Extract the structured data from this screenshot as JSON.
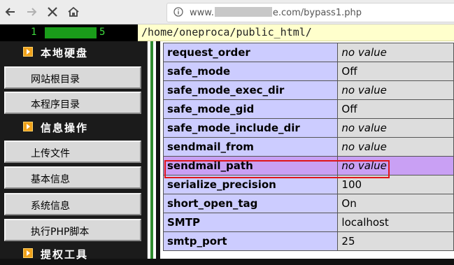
{
  "browser": {
    "url_prefix": "www.",
    "url_suffix": "e.com/bypass1.php"
  },
  "header": {
    "host_start": "1",
    "host_end": "5",
    "path": "/home/oneproca/public_html/"
  },
  "sidebar": {
    "sections": [
      {
        "label": "本地硬盘",
        "items": [
          "网站根目录",
          "本程序目录"
        ]
      },
      {
        "label": "信息操作",
        "items": [
          "上传文件",
          "基本信息",
          "系统信息",
          "执行PHP脚本"
        ]
      },
      {
        "label": "提权工具",
        "items": []
      }
    ]
  },
  "table": {
    "rows": [
      {
        "key": "request_order",
        "value": "no value",
        "italic": true
      },
      {
        "key": "safe_mode",
        "value": "Off",
        "italic": false
      },
      {
        "key": "safe_mode_exec_dir",
        "value": "no value",
        "italic": true
      },
      {
        "key": "safe_mode_gid",
        "value": "Off",
        "italic": false
      },
      {
        "key": "safe_mode_include_dir",
        "value": "no value",
        "italic": true
      },
      {
        "key": "sendmail_from",
        "value": "no value",
        "italic": true
      },
      {
        "key": "sendmail_path",
        "value": "no value",
        "italic": true,
        "highlighted": true
      },
      {
        "key": "serialize_precision",
        "value": "100",
        "italic": false
      },
      {
        "key": "short_open_tag",
        "value": "On",
        "italic": false
      },
      {
        "key": "SMTP",
        "value": "localhost",
        "italic": false
      },
      {
        "key": "smtp_port",
        "value": "25",
        "italic": false
      }
    ],
    "highlight_color": "#e0161a"
  }
}
